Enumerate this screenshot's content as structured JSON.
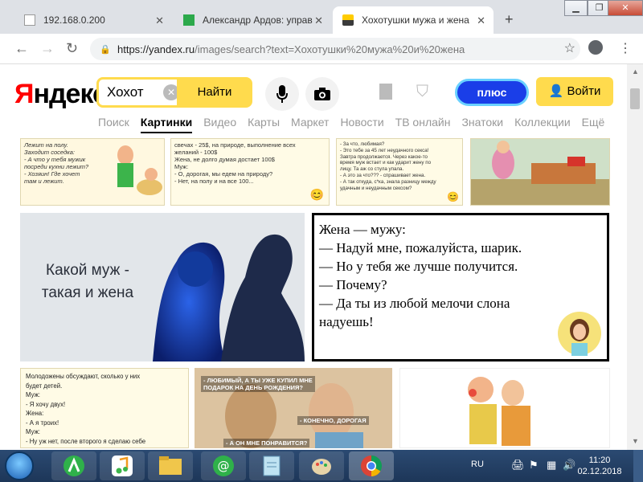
{
  "browser": {
    "tabs": [
      {
        "label": "192.168.0.200",
        "active": false
      },
      {
        "label": "Александр Ардов: управ",
        "active": false
      },
      {
        "label": "Хохотушки мужа и жена",
        "active": true
      }
    ],
    "url_host": "https://yandex.ru",
    "url_path": "/images/search?text=Хохотушки%20мужа%20и%20жена"
  },
  "yandex": {
    "logo_first": "Я",
    "logo_rest": "ндекс",
    "search_value": "Хохот",
    "find_label": "Найти",
    "plus_label": "плюс",
    "login_label": "Войти",
    "services": [
      "Поиск",
      "Картинки",
      "Видео",
      "Карты",
      "Маркет",
      "Новости",
      "ТВ онлайн",
      "Знатоки",
      "Коллекции",
      "Ещё"
    ],
    "active_service": "Картинки"
  },
  "results": {
    "card1_text": "Лежит на полу.\nЗаходит соседка:\n- А что у тебя мужик\nпосреди кухни лежит?\n- Хозяин! Где хочет\nтам и лежит.",
    "card2_text": "свечах - 25$, на природе, выполнение всех\nжеланий - 100$\nЖена, не долго думая достает 100$\nМуж:\n- О, дорогая, мы едем на природу?\n- Нет, на полу и на все 100...",
    "card3_text": "- За что, любимая?\n- Это тебе за 45 лет неудачного секса!\nЗавтра продолжается. Через какое-то\nвремя муж встает и как ударит жену по\nлицу. Та аж со стула упала.\n- А это за что??? - спрашивает жена.\n- А так откуда, с*ка, знала разницу между\nудачным и неудачным сексом?",
    "big_left_caption": "Какой муж -\nтакая и жена",
    "big_right_joke": "Жена — мужу:\n— Надуй мне, пожалуйста, шарик.\n— Но у тебя же лучше получится.\n— Почему?\n— Да ты из любой мелочи слона\nнадуешь!",
    "bottom_card1_text": "Молодожены обсуждают, сколько у них\nбудет детей.\nМуж:\n - Я хочу двух!\nЖена:\n - А я троих!\nМуж:\n - Ну уж нет, после второго я сделаю себе",
    "bottom_card2_bubble1": "- ЛЮБИМЫЙ, А ТЫ УЖЕ КУПИЛ МНЕ\nПОДАРОК НА ДЕНЬ РОЖДЕНИЯ?",
    "bottom_card2_bubble2": "- КОНЕЧНО, ДОРОГАЯ",
    "bottom_card2_bubble3": "- А ОН МНЕ ПОНРАВИТСЯ?"
  },
  "taskbar": {
    "lang": "RU",
    "time": "11:20",
    "date": "02.12.2018"
  },
  "colors": {
    "yandex_yellow": "#ffdb4d",
    "plus_blue": "#1a3ee8",
    "logo_red": "#ff0000"
  }
}
